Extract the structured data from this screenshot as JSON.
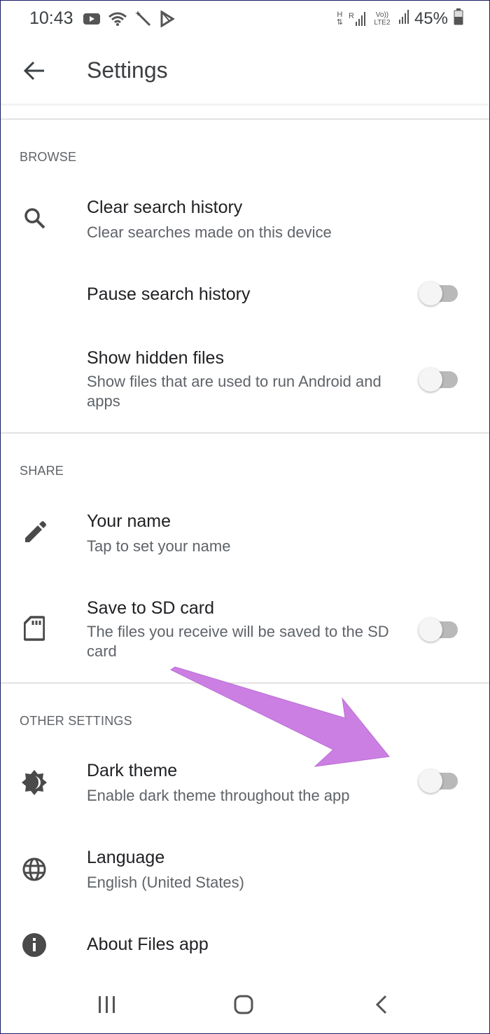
{
  "status_bar": {
    "time": "10:43",
    "battery_percent": "45%",
    "network_label_1": "H",
    "network_label_2": "R",
    "network_label_3": "Vo)) LTE2",
    "icons": [
      "youtube-icon",
      "wifi-icon",
      "magic-wand-icon",
      "play-store-icon",
      "signal-icon",
      "battery-icon"
    ]
  },
  "app_bar": {
    "title": "Settings",
    "back_icon": "arrow-back-icon"
  },
  "sections": {
    "browse": {
      "header": "BROWSE",
      "clear_history": {
        "title": "Clear search history",
        "subtitle": "Clear searches made on this device",
        "icon": "search-icon"
      },
      "pause_history": {
        "title": "Pause search history",
        "toggle_on": false
      },
      "hidden_files": {
        "title": "Show hidden files",
        "subtitle": "Show files that are used to run Android and apps",
        "toggle_on": false
      }
    },
    "share": {
      "header": "SHARE",
      "your_name": {
        "title": "Your name",
        "subtitle": "Tap to set your name",
        "icon": "pencil-icon"
      },
      "sd_card": {
        "title": "Save to SD card",
        "subtitle": "The files you receive will be saved to the SD card",
        "icon": "sd-card-icon",
        "toggle_on": false
      }
    },
    "other": {
      "header": "OTHER SETTINGS",
      "dark_theme": {
        "title": "Dark theme",
        "subtitle": "Enable dark theme throughout the app",
        "icon": "brightness-icon",
        "toggle_on": false
      },
      "language": {
        "title": "Language",
        "subtitle": "English (United States)",
        "icon": "globe-icon"
      },
      "about": {
        "title": "About Files app",
        "icon": "info-icon"
      }
    }
  },
  "colors": {
    "accent_arrow": "#cc7fe3",
    "icon": "#4a4a4a",
    "toggle_track": "#b9b9b9",
    "toggle_knob": "#f5f5f5"
  }
}
